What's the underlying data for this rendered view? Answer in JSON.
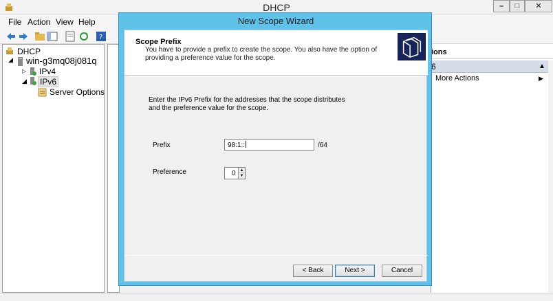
{
  "window": {
    "title": "DHCP",
    "minimize": "–",
    "maximize": "□",
    "close": "✕"
  },
  "menu": [
    "File",
    "Action",
    "View",
    "Help"
  ],
  "tree": {
    "root": "DHCP",
    "server": "win-g3mq08j081q",
    "ipv4": "IPv4",
    "ipv6": "IPv6",
    "server_options": "Server Options"
  },
  "actions": {
    "header": "ions",
    "subheader": "6",
    "more_actions": "More Actions"
  },
  "wizard": {
    "title": "New Scope Wizard",
    "header_title": "Scope Prefix",
    "header_description": "You have to provide a prefix to create the scope. You also have the option of providing a preference value for the scope.",
    "intro": "Enter the IPv6 Prefix for the addresses that the scope distributes and the preference value for the scope.",
    "prefix_label": "Prefix",
    "prefix_value": "98:1::",
    "prefix_suffix": "/64",
    "preference_label": "Preference",
    "preference_value": "0",
    "back_button": "< Back",
    "next_button": "Next >",
    "cancel_button": "Cancel"
  },
  "colors": {
    "wizard_frame": "#5fc2e9",
    "dialog_face": "#f0f0f0",
    "actions_subheader": "#d4dde8"
  }
}
